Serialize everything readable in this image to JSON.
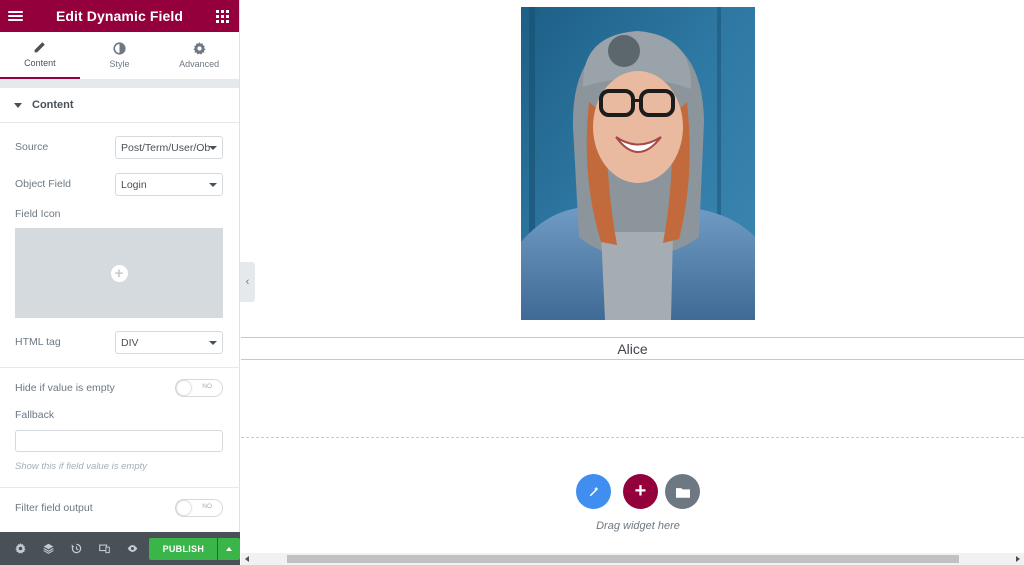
{
  "header": {
    "title": "Edit Dynamic Field",
    "menu_icon": "hamburger-icon",
    "apps_icon": "grid-icon"
  },
  "tabs": [
    {
      "label": "Content",
      "icon": "pencil-icon",
      "active": true
    },
    {
      "label": "Style",
      "icon": "contrast-icon",
      "active": false
    },
    {
      "label": "Advanced",
      "icon": "gear-icon",
      "active": false
    }
  ],
  "section": {
    "title": "Content"
  },
  "controls": {
    "source": {
      "label": "Source",
      "value": "Post/Term/User/Ob"
    },
    "object_field": {
      "label": "Object Field",
      "value": "Login"
    },
    "field_icon": {
      "label": "Field Icon"
    },
    "html_tag": {
      "label": "HTML tag",
      "value": "DIV"
    },
    "hide_if_empty": {
      "label": "Hide if value is empty",
      "toggle_text": "NO",
      "on": false
    },
    "fallback": {
      "label": "Fallback",
      "value": "",
      "help": "Show this if field value is empty"
    },
    "filter_output": {
      "label": "Filter field output",
      "toggle_text": "NO",
      "on": false
    }
  },
  "footer": {
    "icons": [
      "settings-icon",
      "layers-icon",
      "history-icon",
      "responsive-icon",
      "preview-eye-icon"
    ],
    "publish_label": "PUBLISH"
  },
  "canvas": {
    "name_value": "Alice",
    "drag_hint": "Drag widget here"
  },
  "colors": {
    "brand": "#93003c",
    "publish": "#39b54a",
    "ai_button": "#3f8ef0",
    "folder_button": "#6d7882"
  }
}
